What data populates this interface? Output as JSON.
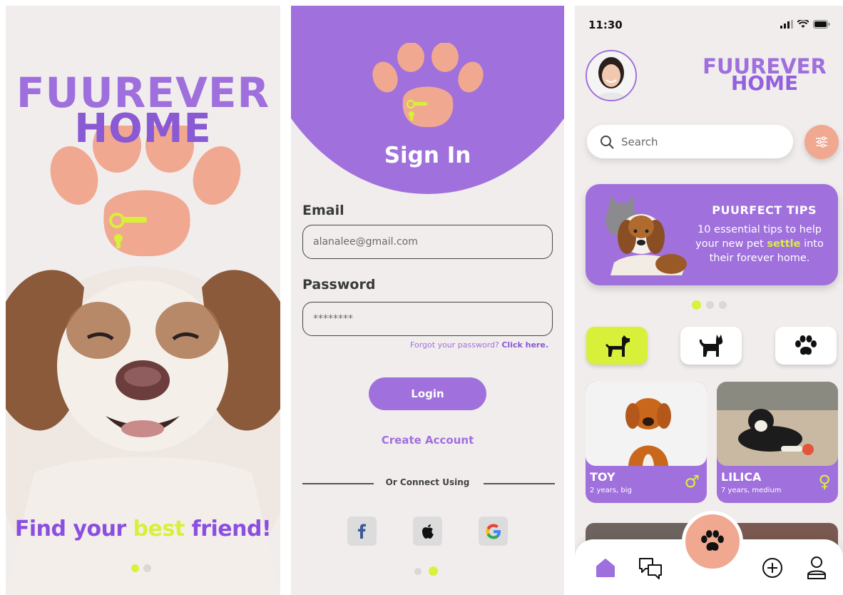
{
  "screen1": {
    "brand_line1": "FUUREVER",
    "brand_line2": "HOME",
    "tagline_pre": "Find your ",
    "tagline_highlight": "best",
    "tagline_post": " friend!"
  },
  "screen2": {
    "title": "Sign In",
    "email_label": "Email",
    "email_value": "alanalee@gmail.com",
    "password_label": "Password",
    "password_value": "********",
    "forgot_text": "Forgot your password?",
    "forgot_link": "Click here.",
    "login_label": "Login",
    "create_account": "Create Account",
    "connect_text": "Or Connect Using",
    "social": [
      "facebook-icon",
      "apple-icon",
      "google-icon"
    ]
  },
  "screen3": {
    "time": "11:30",
    "brand_line1": "FUUREVER",
    "brand_line2": "HOME",
    "search_placeholder": "Search",
    "tips": {
      "title": "PUURFECT TIPS",
      "body_pre": "10 essential tips to help your new pet ",
      "body_highlight": "settle",
      "body_post": " into their forever home."
    },
    "categories": [
      "dog-icon",
      "cat-icon",
      "paw-icon"
    ],
    "pets": [
      {
        "name": "TOY",
        "info": "2 years, big",
        "sex": "♂"
      },
      {
        "name": "LILICA",
        "info": "7 years, medium",
        "sex": "♀"
      }
    ],
    "nav": [
      "home-icon",
      "chat-icon",
      "paw-fab-icon",
      "add-icon",
      "profile-icon"
    ]
  },
  "colors": {
    "purple": "#a070dc",
    "lime": "#d8f03a",
    "peach": "#f0a890",
    "background": "#f1eded"
  }
}
